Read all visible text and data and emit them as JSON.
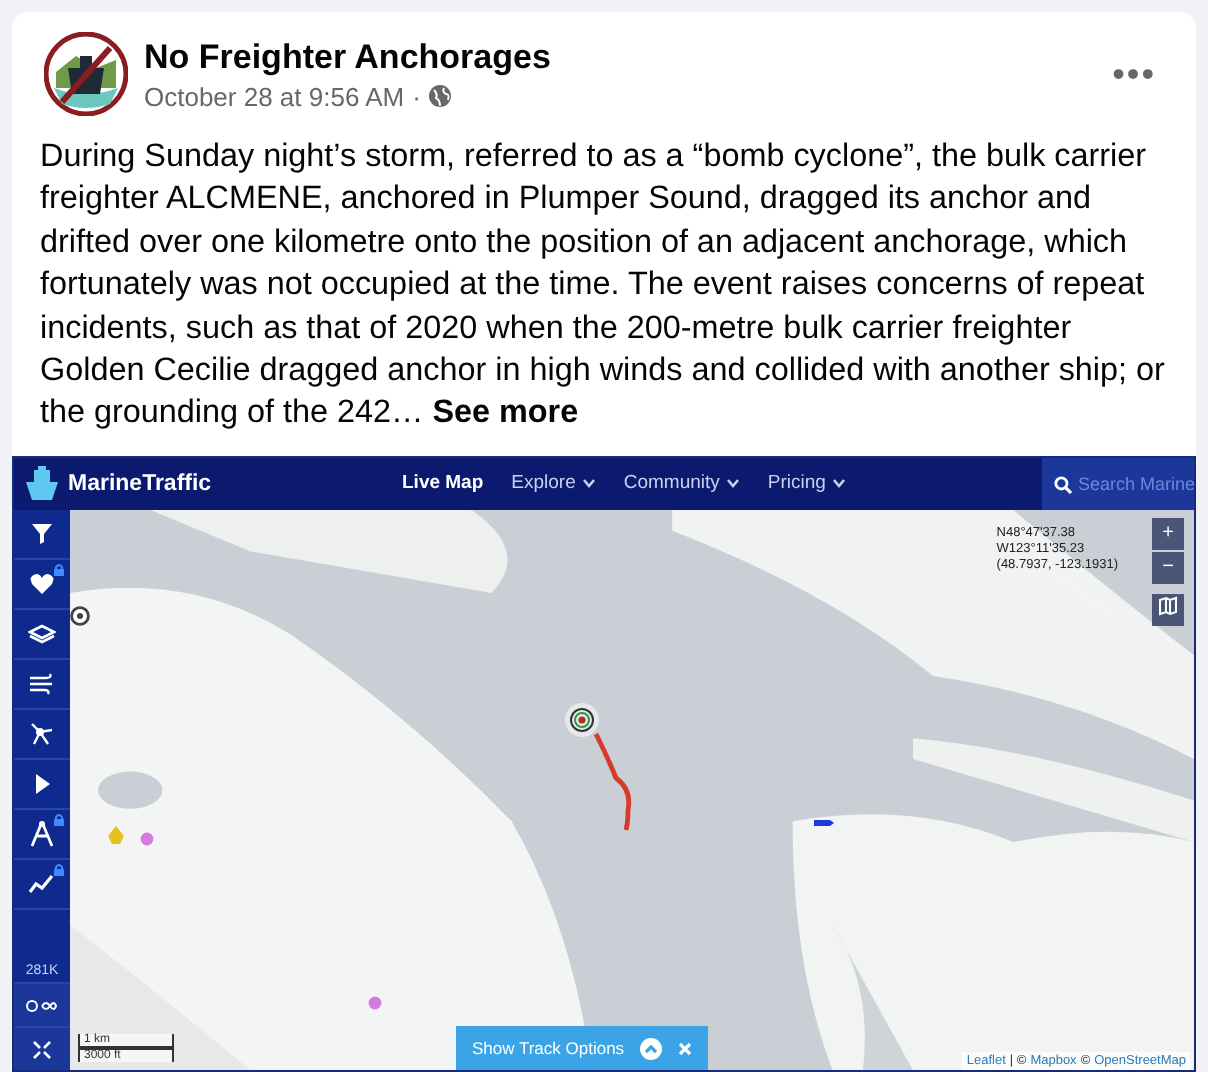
{
  "post": {
    "author": "No Freighter Anchorages",
    "time": "October 28 at 9:56 AM",
    "separator": "·",
    "menu": "•••",
    "text": "During Sunday night’s storm, referred to as a “bomb cyclone”, the bulk carrier freighter ALCMENE, anchored in Plumper Sound, dragged its anchor and drifted over one kilometre onto the position of an adjacent anchorage, which fortunately was not occupied at the time. The event raises concerns of repeat incidents, such as that of 2020 when the 200-metre bulk carrier freighter Golden Cecilie dragged anchor in high winds and collided with another ship; or the grounding of the 242…",
    "see_more": "See more"
  },
  "map": {
    "brand": "MarineTraffic",
    "nav": [
      {
        "label": "Live Map",
        "selected": true,
        "dropdown": false
      },
      {
        "label": "Explore",
        "selected": false,
        "dropdown": true
      },
      {
        "label": "Community",
        "selected": false,
        "dropdown": true
      },
      {
        "label": "Pricing",
        "selected": false,
        "dropdown": true
      }
    ],
    "search": {
      "placeholder": "Search Marine"
    },
    "sidebar": [
      {
        "kind": "filter",
        "locked": false
      },
      {
        "kind": "heart",
        "locked": true
      },
      {
        "kind": "layers",
        "locked": false
      },
      {
        "kind": "wind",
        "locked": false
      },
      {
        "kind": "network",
        "locked": false
      },
      {
        "kind": "play",
        "locked": false
      },
      {
        "kind": "compass",
        "locked": true
      },
      {
        "kind": "chart",
        "locked": true
      }
    ],
    "vessel_count": "281K",
    "coords": [
      "N48°47'37.38",
      "W123°11'35.23",
      "(48.7937, -123.1931)"
    ],
    "zoom": [
      "+",
      "−"
    ],
    "scale": [
      "1 km",
      "3000 ft"
    ],
    "track_button": "Show Track Options",
    "attribution": [
      {
        "text": "Leaflet",
        "link": true
      },
      {
        "text": "| ©",
        "link": false
      },
      {
        "text": "Mapbox",
        "link": true
      },
      {
        "text": "©",
        "link": false
      },
      {
        "text": "OpenStreetMap",
        "link": true
      }
    ]
  }
}
